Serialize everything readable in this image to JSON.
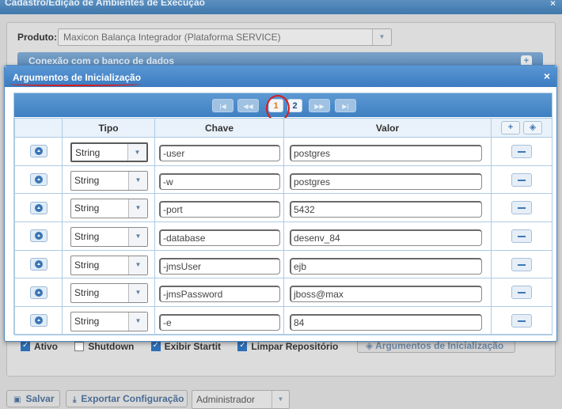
{
  "background_window": {
    "title": "Cadastro/Edição de Ambientes de Execução",
    "close_glyph": "×",
    "produto_label": "Produto:",
    "produto_value": "Maxicon Balança Integrador (Plataforma SERVICE)",
    "conexao_section": "Conexão com o banco de dados",
    "checkboxes": [
      {
        "label": "Ativo",
        "checked": true
      },
      {
        "label": "Shutdown",
        "checked": false
      },
      {
        "label": "Exibir Startit",
        "checked": true
      },
      {
        "label": "Limpar Repositório",
        "checked": true
      }
    ],
    "args_button": "Argumentos de Inicialização",
    "footer": {
      "save": "Salvar",
      "export": "Exportar Configuração",
      "user_select": "Administrador"
    }
  },
  "modal": {
    "title": "Argumentos de Inicialização",
    "close_glyph": "×",
    "pager": {
      "first": "|◀",
      "prev": "◀◀",
      "pages": [
        "1",
        "2"
      ],
      "active_page": "1",
      "next": "▶▶",
      "last": "▶|"
    },
    "columns": {
      "tipo": "Tipo",
      "chave": "Chave",
      "valor": "Valor",
      "add_glyph": "+",
      "tag_glyph": "◈"
    },
    "rows": [
      {
        "tipo": "String",
        "chave": "-user",
        "valor": "postgres"
      },
      {
        "tipo": "String",
        "chave": "-w",
        "valor": "postgres"
      },
      {
        "tipo": "String",
        "chave": "-port",
        "valor": "5432"
      },
      {
        "tipo": "String",
        "chave": "-database",
        "valor": "desenv_84"
      },
      {
        "tipo": "String",
        "chave": "-jmsUser",
        "valor": "ejb"
      },
      {
        "tipo": "String",
        "chave": "-jmsPassword",
        "valor": "jboss@max"
      },
      {
        "tipo": "String",
        "chave": "-e",
        "valor": "84"
      }
    ]
  },
  "colors": {
    "header_blue": "#3b7cc0",
    "annotation_red": "#d91c1c",
    "active_page": "#e2761a"
  }
}
